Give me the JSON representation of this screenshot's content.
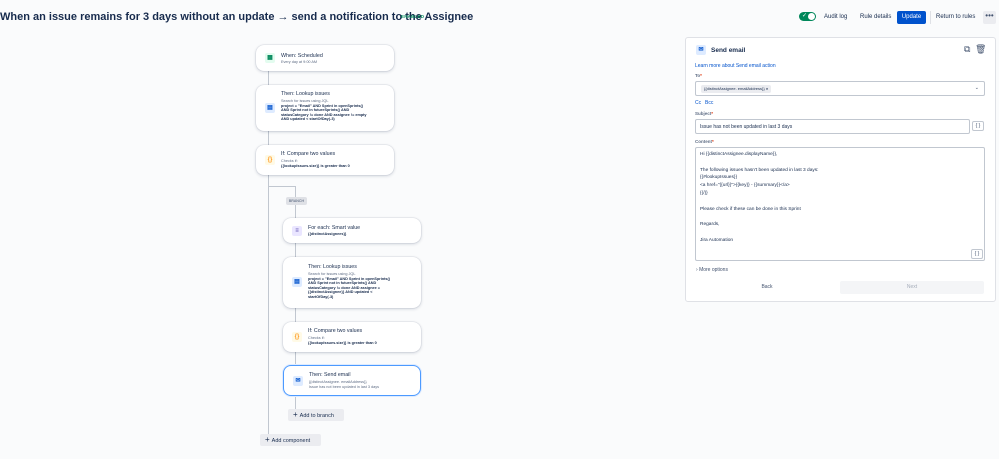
{
  "header": {
    "title": "When an issue remains for 3 days without an update → send a notification to the Assignee",
    "status_badge": "ENABLED",
    "audit_log": "Audit log",
    "rule_details": "Rule details",
    "update": "Update",
    "return_to_rules": "Return to rules",
    "more": "•••"
  },
  "flow": {
    "trigger": {
      "title": "When: Scheduled",
      "sub": "Every day at 9:00 AM"
    },
    "lookup1": {
      "title": "Then: Lookup issues",
      "sub1": "Search for issues using JQL",
      "sub2": "project = \"Email\" AND Sprint in openSprints()",
      "sub3": "AND Sprint not in futureSprints() AND",
      "sub4": "statusCategory != done AND assignee != empty",
      "sub5": "AND updated < startOfDay(-3)"
    },
    "compare1": {
      "title": "If: Compare two values",
      "sub1": "Checks if:",
      "sub2": "{{lookupIssues.size}} is greater than 0"
    },
    "branch_label": "BRANCH",
    "foreach": {
      "title": "For each: Smart value",
      "sub": "{{distinctAssignees}}"
    },
    "lookup2": {
      "title": "Then: Lookup issues",
      "sub1": "Search for issues using JQL",
      "sub2": "project = \"Email\" AND Sprint in openSprints()",
      "sub3": "AND Sprint not in futureSprints() AND",
      "sub4": "statusCategory != done AND assignee =",
      "sub5": "{{distinctAssignee}} AND updated <",
      "sub6": "startOfDay(-3)"
    },
    "compare2": {
      "title": "If: Compare two values",
      "sub1": "Checks if:",
      "sub2": "{{lookupIssues.size}} is greater than 0"
    },
    "sendemail": {
      "title": "Then: Send email",
      "sub1": "{{distinctAssignee. emailAddress}}",
      "sub2": "Issue has not been updated in last 3 days"
    },
    "add_to_branch": "Add to branch",
    "add_component": "Add component"
  },
  "panel": {
    "title": "Send email",
    "learn_more": "Learn more about Send email action",
    "to_label": "To",
    "to_value": "{{distinctAssignee. emailAddress}}",
    "cc": "Cc",
    "bcc": "Bcc",
    "subject_label": "Subject",
    "subject_value": "Issue has not been updated in last 3 days",
    "content_label": "Content",
    "content_lines": [
      "Hi {{distinctAssignee.displayName}},",
      "",
      "The following issues hasn't been updated in last 3 days:",
      "{{#lookupIssues}}",
      "<a href=\"{{url}}\">{{key}} - {{summary}}</a>",
      "{{/}}",
      "",
      "Please check if these can be done in this Sprint",
      "",
      "Regards,",
      "",
      "Jira Automation"
    ],
    "braces": "{ }",
    "more_options": "More options",
    "back": "Back",
    "next": "Next"
  },
  "colors": {
    "accent": "#0052cc",
    "enabled": "#00875a",
    "selected_border": "#4c9aff"
  }
}
